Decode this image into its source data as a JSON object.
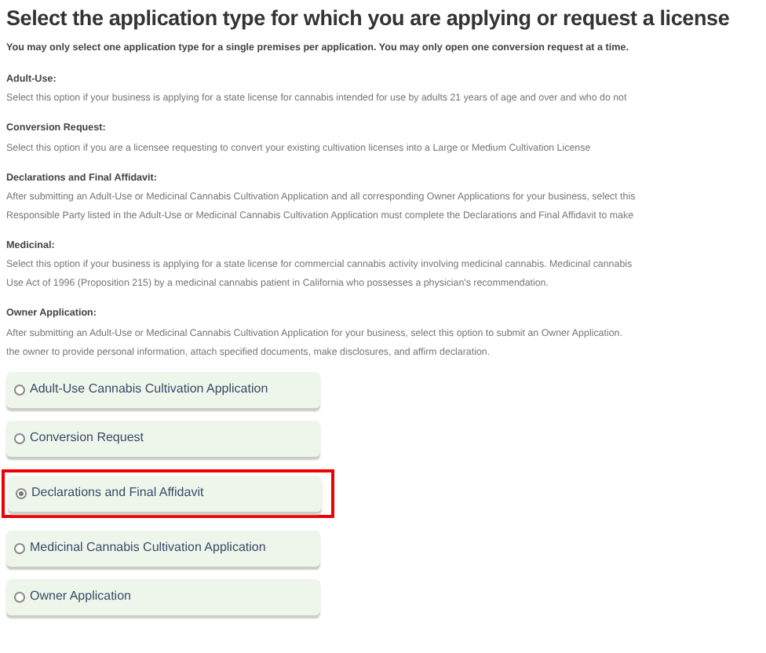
{
  "title": "Select the application type for which you are applying or request a license",
  "subtitle": "You may only select one application type for a single premises per application. You may only open one conversion request at a time.",
  "sections": [
    {
      "label": "Adult-Use:",
      "lines": [
        "Select this option if your business is applying for a state license for cannabis intended for use by adults 21 years of age and over and who do not"
      ]
    },
    {
      "label": "Conversion Request:",
      "lines": [
        "Select this option if you are a licensee requesting to convert your existing cultivation licenses into a Large or Medium Cultivation License"
      ]
    },
    {
      "label": "Declarations and Final Affidavit:",
      "lines": [
        "After submitting an Adult-Use or Medicinal Cannabis Cultivation Application and all corresponding Owner Applications for your business, select this",
        "Responsible Party listed in the Adult-Use or Medicinal Cannabis Cultivation Application must complete the Declarations and Final Affidavit to make"
      ]
    },
    {
      "label": "Medicinal:",
      "lines": [
        "Select this option if your business is applying for a state license for commercial cannabis activity involving medicinal cannabis. Medicinal cannabis",
        "Use Act of 1996 (Proposition 215) by a medicinal cannabis patient in California who possesses a physician's recommendation."
      ]
    },
    {
      "label": "Owner Application:",
      "lines": [
        "After submitting an Adult-Use or Medicinal Cannabis Cultivation Application for your business, select this option to submit an Owner Application.",
        "the owner to provide personal information, attach specified documents, make disclosures, and affirm declaration."
      ]
    }
  ],
  "options": [
    {
      "label": "Adult-Use Cannabis Cultivation Application",
      "selected": false
    },
    {
      "label": "Conversion Request",
      "selected": false
    },
    {
      "label": "Declarations and Final Affidavit",
      "selected": true
    },
    {
      "label": "Medicinal Cannabis Cultivation Application",
      "selected": false
    },
    {
      "label": "Owner Application",
      "selected": false
    }
  ]
}
